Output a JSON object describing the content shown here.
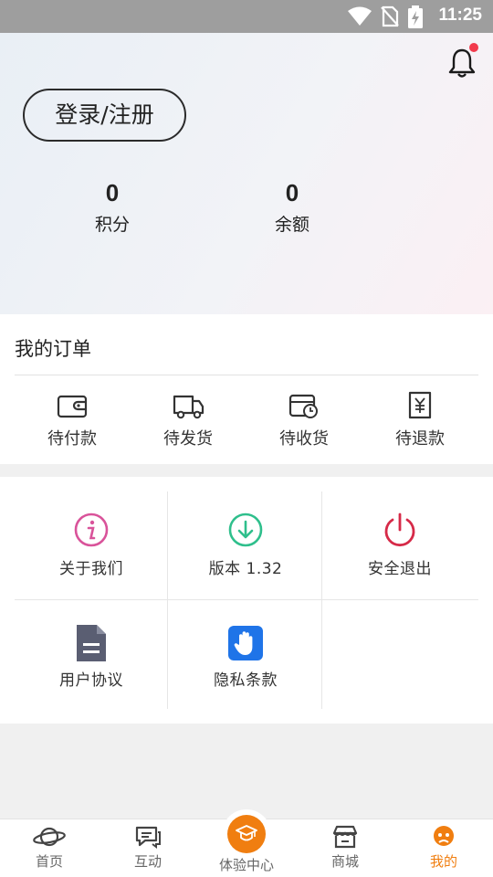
{
  "status_bar": {
    "time": "11:25",
    "icons": [
      "wifi-icon",
      "no-sim-icon",
      "battery-charging-icon"
    ]
  },
  "header": {
    "notification_icon": "bell-icon",
    "has_notification_dot": true,
    "login_label": "登录/注册",
    "stats": [
      {
        "value": "0",
        "label": "积分"
      },
      {
        "value": "0",
        "label": "余额"
      }
    ]
  },
  "orders": {
    "title": "我的订单",
    "items": [
      {
        "label": "待付款",
        "icon": "wallet-icon"
      },
      {
        "label": "待发货",
        "icon": "truck-icon"
      },
      {
        "label": "待收货",
        "icon": "package-clock-icon"
      },
      {
        "label": "待退款",
        "icon": "refund-receipt-icon"
      }
    ]
  },
  "menu": {
    "items": [
      {
        "label": "关于我们",
        "icon": "info-icon",
        "color": "#d9539a"
      },
      {
        "label": "版本 1.32",
        "icon": "download-icon",
        "color": "#2fbf8c"
      },
      {
        "label": "安全退出",
        "icon": "power-icon",
        "color": "#d62a48"
      },
      {
        "label": "用户协议",
        "icon": "document-icon",
        "color": "#5a5e72"
      },
      {
        "label": "隐私条款",
        "icon": "hand-icon",
        "color": "#1f74e8"
      }
    ]
  },
  "tabbar": {
    "accent": "#f07e10",
    "tabs": [
      {
        "label": "首页",
        "icon": "planet-icon",
        "active": false
      },
      {
        "label": "互动",
        "icon": "chat-icon",
        "active": false
      },
      {
        "label": "体验中心",
        "icon": "graduate-icon",
        "active": false
      },
      {
        "label": "商城",
        "icon": "store-icon",
        "active": false
      },
      {
        "label": "我的",
        "icon": "mascot-icon",
        "active": true
      }
    ]
  }
}
